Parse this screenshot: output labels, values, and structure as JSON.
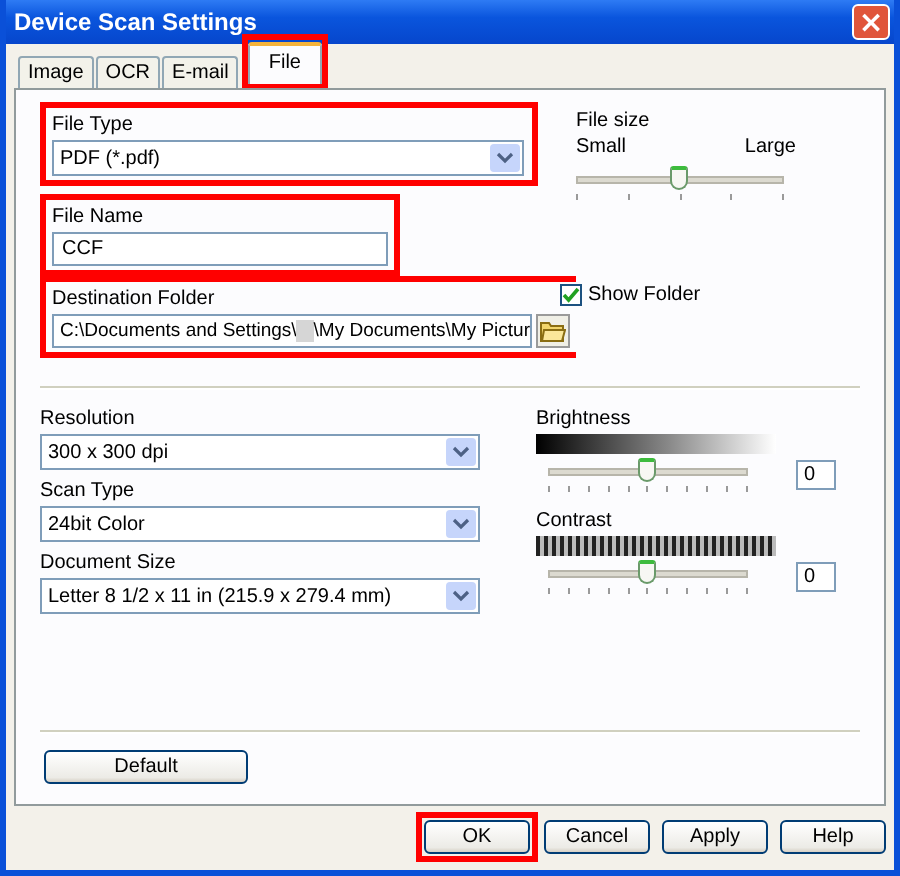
{
  "window": {
    "title": "Device Scan Settings",
    "close": "×"
  },
  "tabs": [
    {
      "label": "Image",
      "selected": false,
      "highlighted": false
    },
    {
      "label": "OCR",
      "selected": false,
      "highlighted": false
    },
    {
      "label": "E-mail",
      "selected": false,
      "highlighted": false
    },
    {
      "label": "File",
      "selected": true,
      "highlighted": true
    }
  ],
  "file_type": {
    "label": "File Type",
    "value": "PDF (*.pdf)",
    "highlighted": true
  },
  "file_size": {
    "label": "File size",
    "min_label": "Small",
    "max_label": "Large",
    "level": 0.5
  },
  "file_name": {
    "label": "File Name",
    "value": "CCF",
    "highlighted": true
  },
  "destination_folder": {
    "label": "Destination Folder",
    "value_start": "C:\\Documents and Settings\\",
    "value_end": "\\My Documents\\My Pictur",
    "highlighted": true
  },
  "show_folder": {
    "label": "Show Folder",
    "checked": true
  },
  "combos": [
    {
      "label": "Resolution",
      "value": "300 x 300 dpi"
    },
    {
      "label": "Scan Type",
      "value": "24bit Color"
    },
    {
      "label": "Document Size",
      "value": "Letter 8 1/2 x 11 in (215.9 x 279.4 mm)"
    }
  ],
  "adjustments": [
    {
      "label": "Brightness",
      "kind": "gradient",
      "level": 0.5,
      "value": "0"
    },
    {
      "label": "Contrast",
      "kind": "stripes",
      "level": 0.5,
      "value": "0"
    }
  ],
  "default_button": "Default",
  "buttons": [
    {
      "label": "OK",
      "highlighted": true
    },
    {
      "label": "Cancel",
      "highlighted": false
    },
    {
      "label": "Apply",
      "highlighted": false
    },
    {
      "label": "Help",
      "highlighted": false
    }
  ]
}
